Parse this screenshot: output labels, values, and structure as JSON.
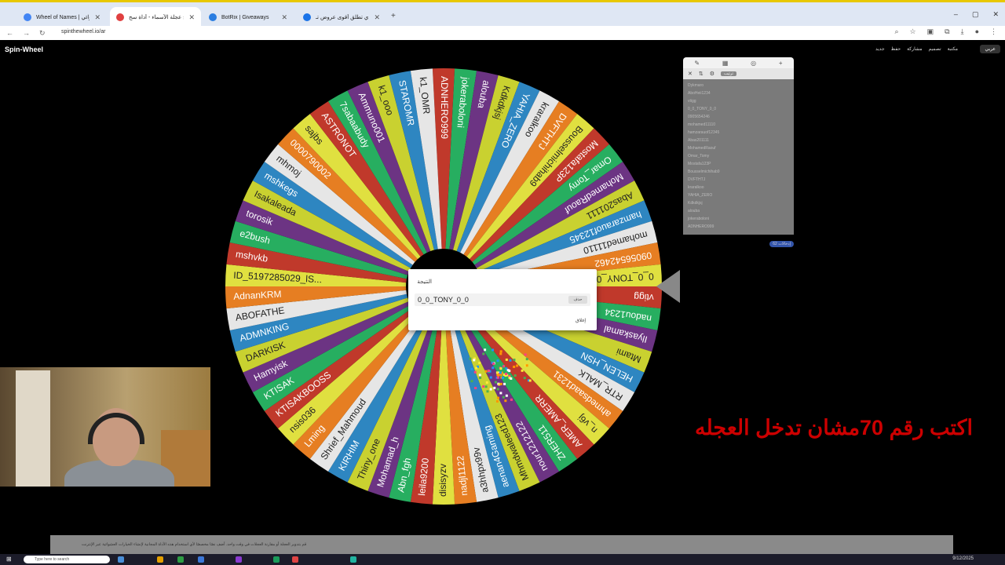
{
  "browser": {
    "tabs": [
      {
        "title": "Wheel of Names | إسم العشوائي",
        "active": false,
        "color": "#4285f4"
      },
      {
        "title": "برنامج عجلة الأسماء - أداة سح...",
        "active": true,
        "color": "#e04040"
      },
      {
        "title": "BotRix | Giveaways",
        "active": false,
        "color": "#2a7de1"
      },
      {
        "title": "مداس باي تطلق أقوى عروض تـ...",
        "active": false,
        "color": "#1a73e8"
      }
    ],
    "address": "spinthewheel.io/ar",
    "window_controls": [
      "–",
      "▢",
      "✕"
    ]
  },
  "site": {
    "logo": "Spin-Wheel",
    "menu": [
      "جديد",
      "حفظ",
      "مشاركة",
      "تصميم",
      "مكتبة"
    ],
    "language_button": "عربي"
  },
  "wheel": {
    "pointer_color": "#888888",
    "segment_colors": [
      "#c0392b",
      "#27ae60",
      "#6c3483",
      "#c9d130",
      "#2e86c1",
      "#e6e6e6",
      "#e67e22",
      "#e0e040"
    ],
    "entries": [
      "ADNHERO999",
      "jokeraboloni",
      "alouba",
      "Kdkdkjsj",
      "YAHIA_ZERO",
      "kraralkoo",
      "DVFTHTJ",
      "Bousselmichihab9",
      "Mostafa123P",
      "Omar_Tomy",
      "MohamedRaouf",
      "Abas201111",
      "hamzarauof12345",
      "mohamed11110",
      "09056542462",
      "0_0_TONY_0_0",
      "vtigg",
      "nadou1234",
      "Ilyaskamal",
      "Mtami",
      "HELEN_HSN",
      "RTR_MALK",
      "ahmedsaad1231",
      "n_v6j",
      "AMER_AMERR",
      "ZHER511",
      "nour1212122",
      "Mhmdwaleed123",
      "aenan4Gaming",
      "a3hhpx99v",
      "nadjl1122",
      "disisyzv",
      "leila9200",
      "Abn_fgh",
      "Mohamad_h",
      "Thiny_one",
      "KIRHIM",
      "Shrief_Mahmoud",
      "Lming",
      "nsis036",
      "KTISAKBOOSS",
      "KTISAK",
      "Hamyisk",
      "DARKISK",
      "ADMNKING",
      "ABOFATHE",
      "AdnanKRM",
      "ID_5197285029_lS...",
      "mshvkb",
      "e2bush",
      "torosik",
      "Isakaleada",
      "mshkegs",
      "mhmoj",
      "0000790002",
      "sajbs",
      "ASTRONOT",
      "7sabaabudy",
      "Ammuno001",
      "k1_ooo",
      "STAROMR",
      "k1_OMR"
    ]
  },
  "dialog": {
    "title": "النتيجة",
    "winner": "0_0_TONY_0_0",
    "remove_label": "حذف",
    "close_label": "إغلاق"
  },
  "panel": {
    "tab_icons": [
      "✎",
      "▦",
      "◎",
      "+"
    ],
    "tool_icons": [
      "✕",
      "⇅",
      "⚙"
    ],
    "tool_button": "ترتيب",
    "entries": [
      "Dykmaro",
      "AboHeii1234",
      "vtigg",
      "0_0_TONY_0_0",
      "0905654246",
      "mohamed11110",
      "hamzarauof12345",
      "Abas201111",
      "MohamedRaouf",
      "Omar_Tomy",
      "Mostafa123P",
      "Bousselmichihab9",
      "DVFTHTJ",
      "kraralkoo",
      "YAHIA_ZERO",
      "Kdkdkjsj",
      "alouba",
      "jokeraboloni",
      "ADNHERO999"
    ],
    "count_badge": "62 إدخالات"
  },
  "overlay": {
    "text": "اكتب رقم 70مشان تدخل العجله",
    "color": "#cc0000"
  },
  "footer": {
    "notice": "قم بتدوير العجلة أو مقارنة العجلات في وقت واحد. أضف نصًا مخصصًا لأي استخدام هذه الأداة المجانية لإنشاء الخيارات العشوائية عبر الإنترنت"
  },
  "taskbar": {
    "search_placeholder": "Type here to search",
    "clock": "9/12/2025"
  }
}
